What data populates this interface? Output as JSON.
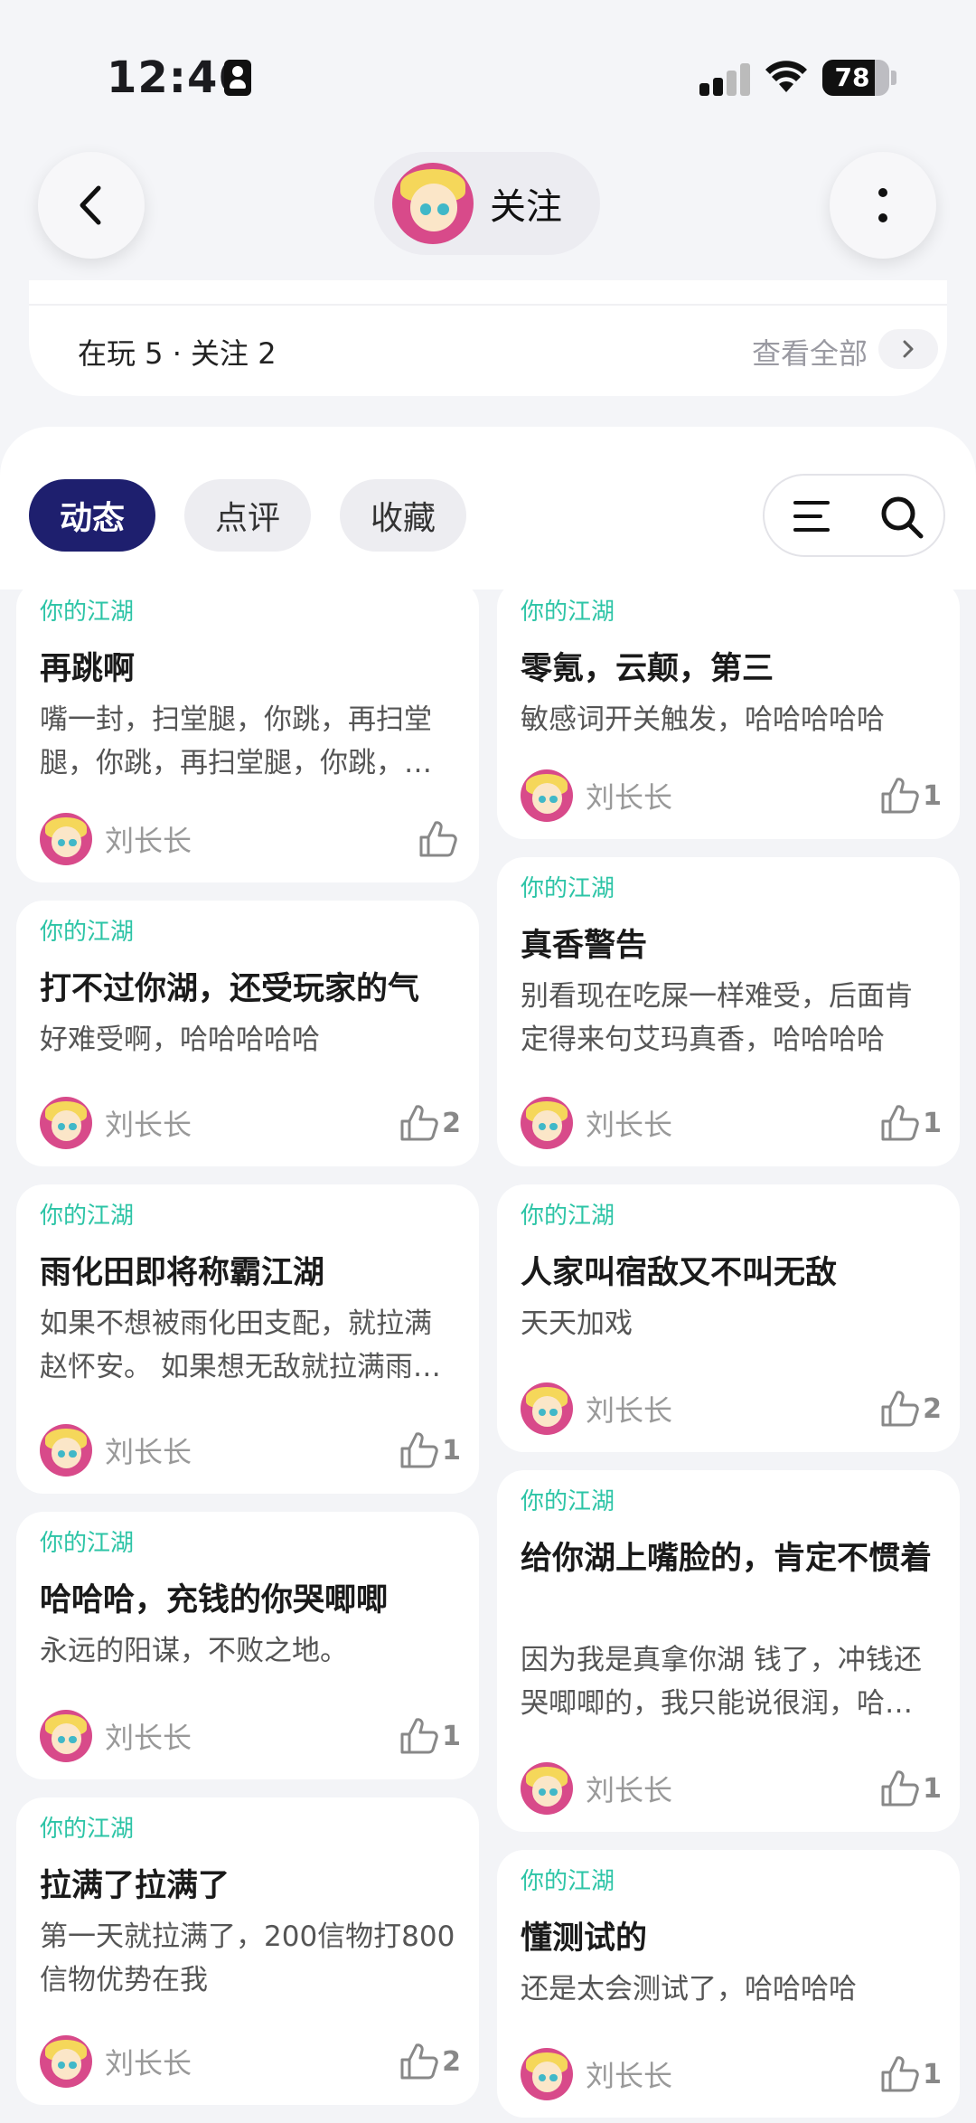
{
  "status_bar": {
    "time": "12:46",
    "battery": "78",
    "battery_level": 0.78
  },
  "header": {
    "title": "关注"
  },
  "stats": {
    "text": "在玩 5 · 关注 2",
    "see_all": "查看全部"
  },
  "tabs": [
    {
      "label": "动态",
      "active": true
    },
    {
      "label": "点评",
      "active": false
    },
    {
      "label": "收藏",
      "active": false
    }
  ],
  "colors": {
    "accent": "#1e1f6e",
    "tag": "#2cc4a6",
    "avatar": "#d84a8a"
  },
  "posts": [
    {
      "tag": "你的江湖",
      "title": "再跳啊",
      "body": "嘴一封，扫堂腿，你跳，再扫堂腿，你跳，再扫堂腿，你跳，再扫堂腿",
      "author": "刘长长",
      "likes": ""
    },
    {
      "tag": "你的江湖",
      "title": "零氪，云颠，第三",
      "body": "敏感词开关触发，哈哈哈哈哈",
      "author": "刘长长",
      "likes": "1"
    },
    {
      "tag": "你的江湖",
      "title": "真香警告",
      "body": "别看现在吃屎一样难受，后面肯定得来句艾玛真香，哈哈哈哈",
      "author": "刘长长",
      "likes": "1"
    },
    {
      "tag": "你的江湖",
      "title": "打不过你湖，还受玩家的气",
      "body": "好难受啊，哈哈哈哈哈",
      "author": "刘长长",
      "likes": "2"
    },
    {
      "tag": "你的江湖",
      "title": "雨化田即将称霸江湖",
      "body": "如果不想被雨化田支配，就拉满赵怀安。 如果想无敌就拉满雨化田",
      "author": "刘长长",
      "likes": "1"
    },
    {
      "tag": "你的江湖",
      "title": "人家叫宿敌又不叫无敌",
      "body": "天天加戏",
      "author": "刘长长",
      "likes": "2"
    },
    {
      "tag": "你的江湖",
      "title": "哈哈哈，充钱的你哭唧唧",
      "body": "永远的阳谋，不败之地。",
      "author": "刘长长",
      "likes": "1"
    },
    {
      "tag": "你的江湖",
      "title": "给你湖上嘴脸的，肯定不惯着",
      "body": "因为我是真拿你湖 钱了，冲钱还哭唧唧的，我只能说很润，哈哈哈哈",
      "author": "刘长长",
      "likes": "1"
    },
    {
      "tag": "你的江湖",
      "title": "拉满了拉满了",
      "body": "第一天就拉满了，200信物打800信物优势在我",
      "author": "刘长长",
      "likes": "2"
    },
    {
      "tag": "你的江湖",
      "title": "懂测试的",
      "body": "还是太会测试了，哈哈哈哈",
      "author": "刘长长",
      "likes": "1"
    }
  ]
}
